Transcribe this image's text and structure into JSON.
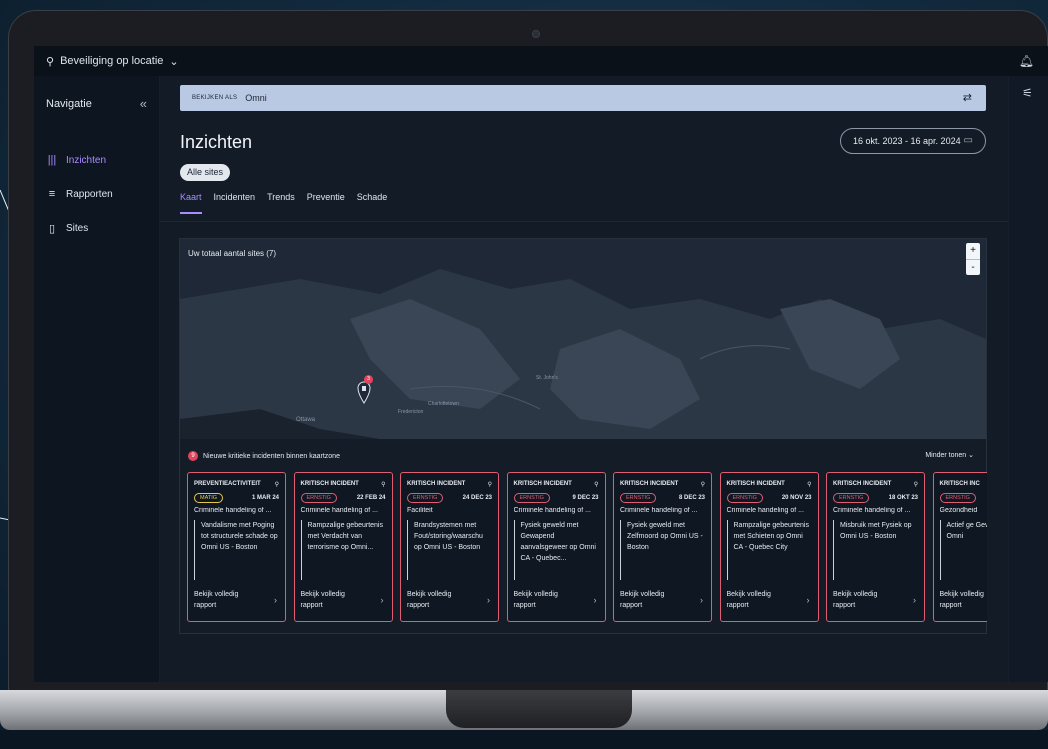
{
  "topbar": {
    "location_label": "Beveiliging op locatie",
    "location_icon": "location-icon",
    "bell_icon": "bell-icon"
  },
  "sidebar": {
    "title": "Navigatie",
    "collapse_glyph": "«",
    "items": [
      {
        "label": "Inzichten",
        "icon": "bar-chart-icon",
        "active": true
      },
      {
        "label": "Rapporten",
        "icon": "list-icon",
        "active": false
      },
      {
        "label": "Sites",
        "icon": "building-icon",
        "active": false
      }
    ]
  },
  "viewbar": {
    "label": "BEKIJKEN ALS",
    "value": "Omni"
  },
  "page": {
    "title": "Inzichten",
    "chip": "Alle sites",
    "date_range": "16 okt. 2023 - 16 apr. 2024"
  },
  "tabs": [
    {
      "label": "Kaart",
      "active": true
    },
    {
      "label": "Incidenten",
      "active": false
    },
    {
      "label": "Trends",
      "active": false
    },
    {
      "label": "Preventie",
      "active": false
    },
    {
      "label": "Schade",
      "active": false
    }
  ],
  "map": {
    "title": "Uw totaal aantal sites (7)",
    "zoom_in": "+",
    "zoom_out": "-",
    "marker_count": "3",
    "labels": {
      "ottawa": "Ottawa",
      "st_johns": "St. John's",
      "charlottetown": "Charlottetown",
      "fredericton": "Fredericton"
    }
  },
  "incidents": {
    "badge": "9",
    "header": "Nieuwe kritieke incidenten binnen kaartzone",
    "less_label": "Minder tonen",
    "report_label": "Bekijk volledig rapport",
    "cards": [
      {
        "type": "PREVENTIEACTIVITEIT",
        "severity": "MATIG",
        "date": "1 MAR 24",
        "subject": "Criminele handeling of ...",
        "desc": "Vandalisme met Poging tot structurele schade op Omni US - Boston"
      },
      {
        "type": "KRITISCH INCIDENT",
        "severity": "ERNSTIG",
        "date": "22 FEB 24",
        "subject": "Criminele handeling of ...",
        "desc": "Rampzalige gebeurtenis met Verdacht van terrorisme op Omni..."
      },
      {
        "type": "KRITISCH INCIDENT",
        "severity": "ERNSTIG",
        "date": "24 DEC 23",
        "subject": "Faciliteit",
        "desc": "Brandsystemen met Fout/storing/waarschu op Omni US - Boston"
      },
      {
        "type": "KRITISCH INCIDENT",
        "severity": "ERNSTIG",
        "date": "9 DEC 23",
        "subject": "Criminele handeling of ...",
        "desc": "Fysiek geweld met Gewapend aanvalsgeweer op Omni CA - Quebec..."
      },
      {
        "type": "KRITISCH INCIDENT",
        "severity": "ERNSTIG",
        "date": "8 DEC 23",
        "subject": "Criminele handeling of ...",
        "desc": "Fysiek geweld met Zelfmoord op Omni US - Boston"
      },
      {
        "type": "KRITISCH INCIDENT",
        "severity": "ERNSTIG",
        "date": "20 NOV 23",
        "subject": "Criminele handeling of ...",
        "desc": "Rampzalige gebeurtenis met Schieten op Omni CA - Quebec City"
      },
      {
        "type": "KRITISCH INCIDENT",
        "severity": "ERNSTIG",
        "date": "18 OKT 23",
        "subject": "Criminele handeling of ...",
        "desc": "Misbruik met Fysiek op Omni US - Boston"
      },
      {
        "type": "KRITISCH INC",
        "severity": "ERNSTIG",
        "date": "",
        "subject": "Gezondheid",
        "desc": "Actief ge Gevaarlij op Omni"
      }
    ]
  },
  "colors": {
    "accent": "#a98cff",
    "severe": "#e05c72",
    "moderate": "#e6c84a",
    "viewbar": "#b9c9e3"
  }
}
